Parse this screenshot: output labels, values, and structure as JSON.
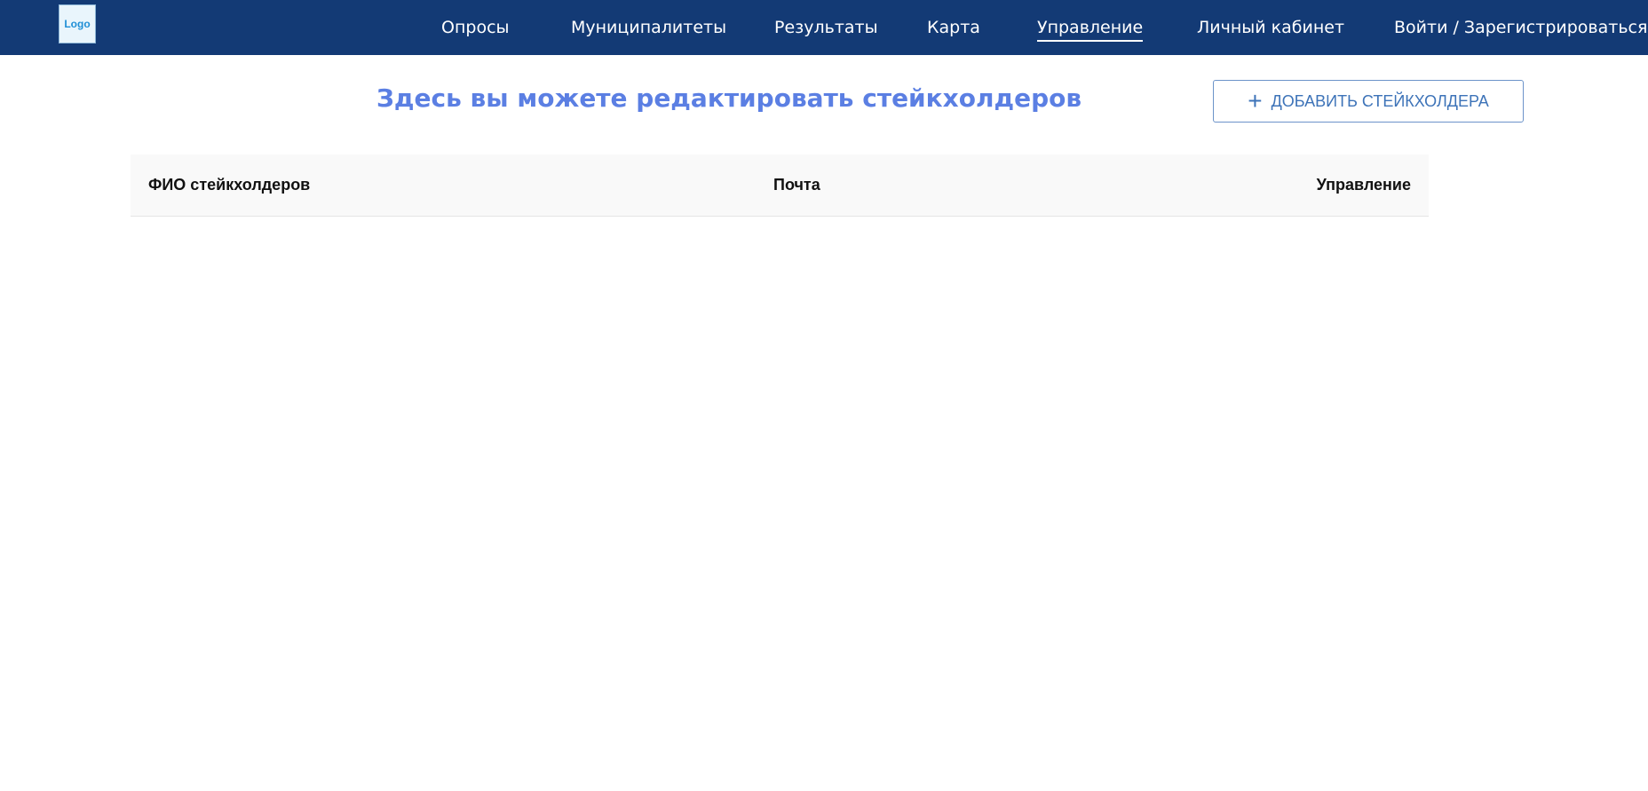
{
  "header": {
    "logo_text": "Logo",
    "nav": [
      {
        "label": "Опросы"
      },
      {
        "label": "Муниципалитеты"
      },
      {
        "label": "Результаты"
      },
      {
        "label": "Карта"
      },
      {
        "label": "Управление",
        "active": true
      },
      {
        "label": "Личный кабинет"
      },
      {
        "label": "Войти / Зарегистрироваться"
      }
    ],
    "background_color": "#133a75"
  },
  "main": {
    "title": "Здесь вы можете редактировать стейкхолдеров",
    "title_color": "#5b7fe3",
    "add_button": {
      "icon": "plus-icon",
      "label": "ДОБАВИТЬ СТЕЙКХОЛДЕРА"
    },
    "table": {
      "columns": [
        "ФИО стейкхолдеров",
        "Почта",
        "Управление"
      ],
      "rows": []
    }
  }
}
